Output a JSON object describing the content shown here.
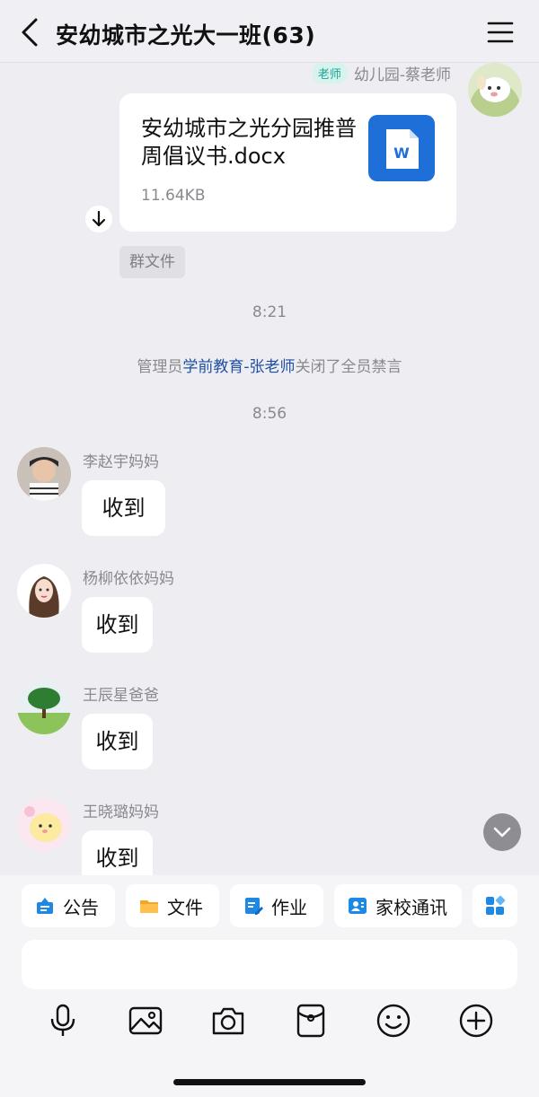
{
  "header": {
    "title": "安幼城市之光大一班(63)",
    "back_icon": "back-chevron-icon",
    "menu_icon": "hamburger-menu-icon"
  },
  "messages": {
    "teacher_file": {
      "role_badge": "老师",
      "sender": "幼儿园-蔡老师",
      "file_name": "安幼城市之光分园推普周倡议书.docx",
      "file_size": "11.64KB",
      "file_tag": "群文件",
      "file_icon": "word-doc-icon"
    },
    "time1": "8:21",
    "system": {
      "prefix": "管理员",
      "highlight": "学前教育-张老师",
      "suffix": "关闭了全员禁言"
    },
    "time2": "8:56",
    "chat": [
      {
        "sender": "李赵宇妈妈",
        "text": "收到"
      },
      {
        "sender": "杨柳依依妈妈",
        "text": "收到"
      },
      {
        "sender": "王辰星爸爸",
        "text": "收到"
      },
      {
        "sender": "王晓璐妈妈",
        "text": "收到"
      }
    ]
  },
  "quick_actions": [
    {
      "label": "公告",
      "icon": "announcement-icon"
    },
    {
      "label": "文件",
      "icon": "folder-icon"
    },
    {
      "label": "作业",
      "icon": "homework-edit-icon"
    },
    {
      "label": "家校通讯",
      "icon": "contacts-icon"
    }
  ],
  "input": {
    "value": "",
    "placeholder": ""
  },
  "toolbar_icons": [
    "microphone-icon",
    "image-icon",
    "camera-icon",
    "red-packet-icon",
    "emoji-icon",
    "plus-icon"
  ],
  "colors": {
    "accent": "#1e6fd8",
    "link": "#1f4fa3",
    "badge": "#1aa394"
  }
}
